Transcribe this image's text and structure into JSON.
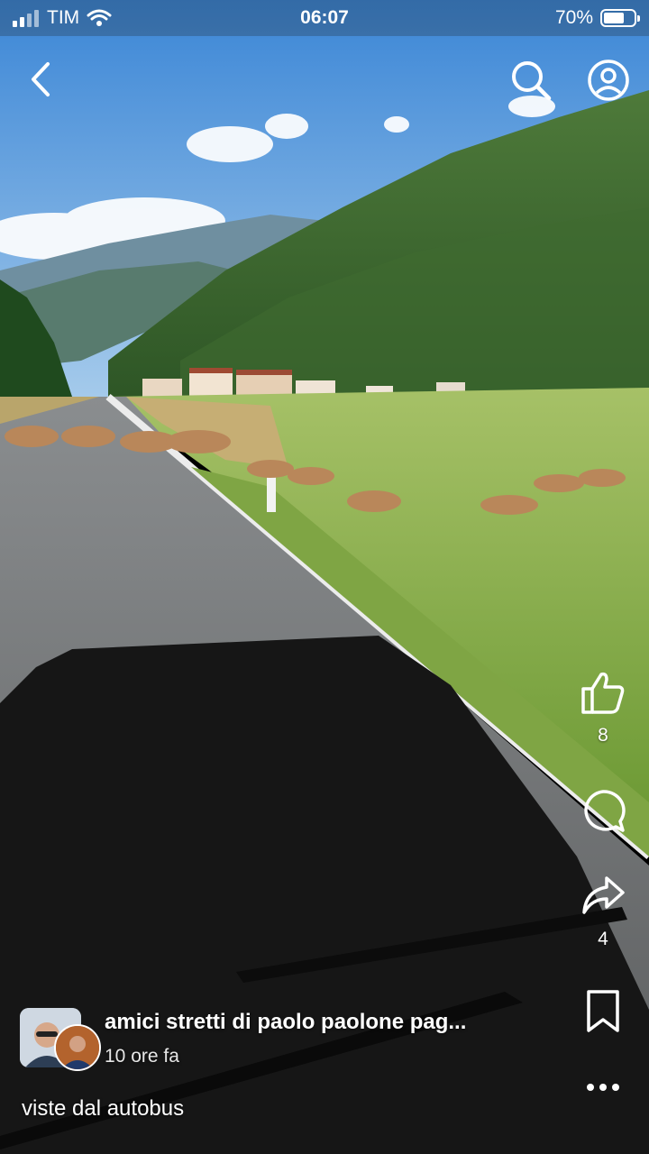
{
  "status_bar": {
    "carrier": "TIM",
    "time": "06:07",
    "battery_text": "70%",
    "battery_level": 0.7
  },
  "header": {
    "back_icon": "chevron-left-icon",
    "search_icon": "search-icon",
    "profile_icon": "profile-icon"
  },
  "actions": {
    "like_count": "8",
    "share_count": "4",
    "like_icon": "thumbs-up-icon",
    "comment_icon": "comment-icon",
    "share_icon": "share-arrow-icon",
    "save_icon": "bookmark-icon",
    "more_icon": "more-dots-icon"
  },
  "post": {
    "group_name": "amici stretti di paolo paolone pag...",
    "time_ago": "10 ore fa",
    "caption": "viste dal autobus"
  },
  "colors": {
    "sky": "#5d9fdd",
    "grass": "#8bb04a",
    "road": "#6a6b6b",
    "shadow": "#141414"
  }
}
